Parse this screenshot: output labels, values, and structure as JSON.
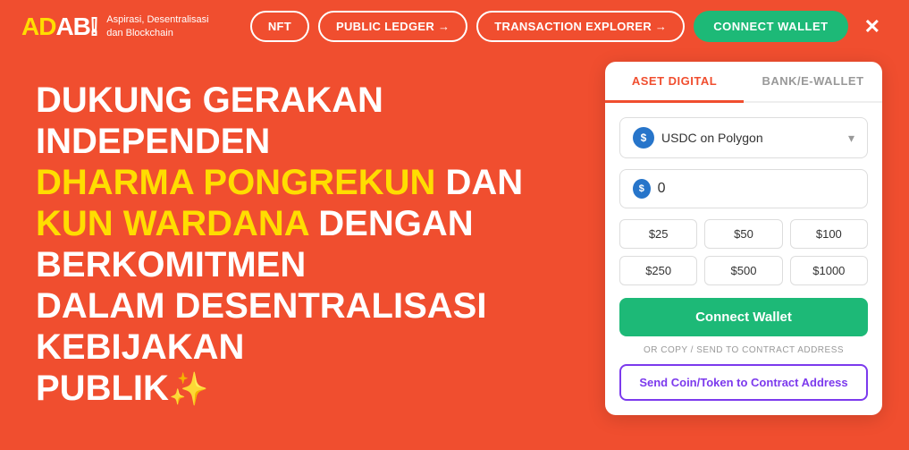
{
  "logo": {
    "adab": "ADAB!",
    "tagline": "Aspirasi, Desentralisasi dan Blockchain"
  },
  "nav": {
    "nft_label": "NFT",
    "public_ledger_label": "PUBLIC LEDGER",
    "transaction_explorer_label": "TRANSACTION EXPLORER",
    "connect_wallet_label": "CONNECT WALLET"
  },
  "hero": {
    "line1": "DUKUNG GERAKAN INDEPENDEN",
    "line2_yellow": "DHARMA PONGREKUN",
    "line2_white": " DAN",
    "line3_yellow": "KUN WARDANA",
    "line3_white": " DENGAN BERKOMITMEN",
    "line4": "DALAM DESENTRALISASI KEBIJAKAN",
    "line5": "PUBLIK"
  },
  "card": {
    "tab1_label": "ASET DIGITAL",
    "tab2_label": "BANK/E-WALLET",
    "token_label": "USDC on Polygon",
    "amount_placeholder": "0",
    "presets": [
      "$25",
      "$50",
      "$100",
      "$250",
      "$500",
      "$1000"
    ],
    "connect_wallet_btn": "Connect Wallet",
    "or_copy_label": "OR COPY / SEND TO CONTRACT ADDRESS",
    "send_token_btn": "Send Coin/Token to Contract Address"
  },
  "colors": {
    "brand_red": "#f04e2f",
    "brand_green": "#1db977",
    "brand_yellow": "#ffdd00",
    "brand_purple": "#7c3aed",
    "usdc_blue": "#2775ca"
  }
}
